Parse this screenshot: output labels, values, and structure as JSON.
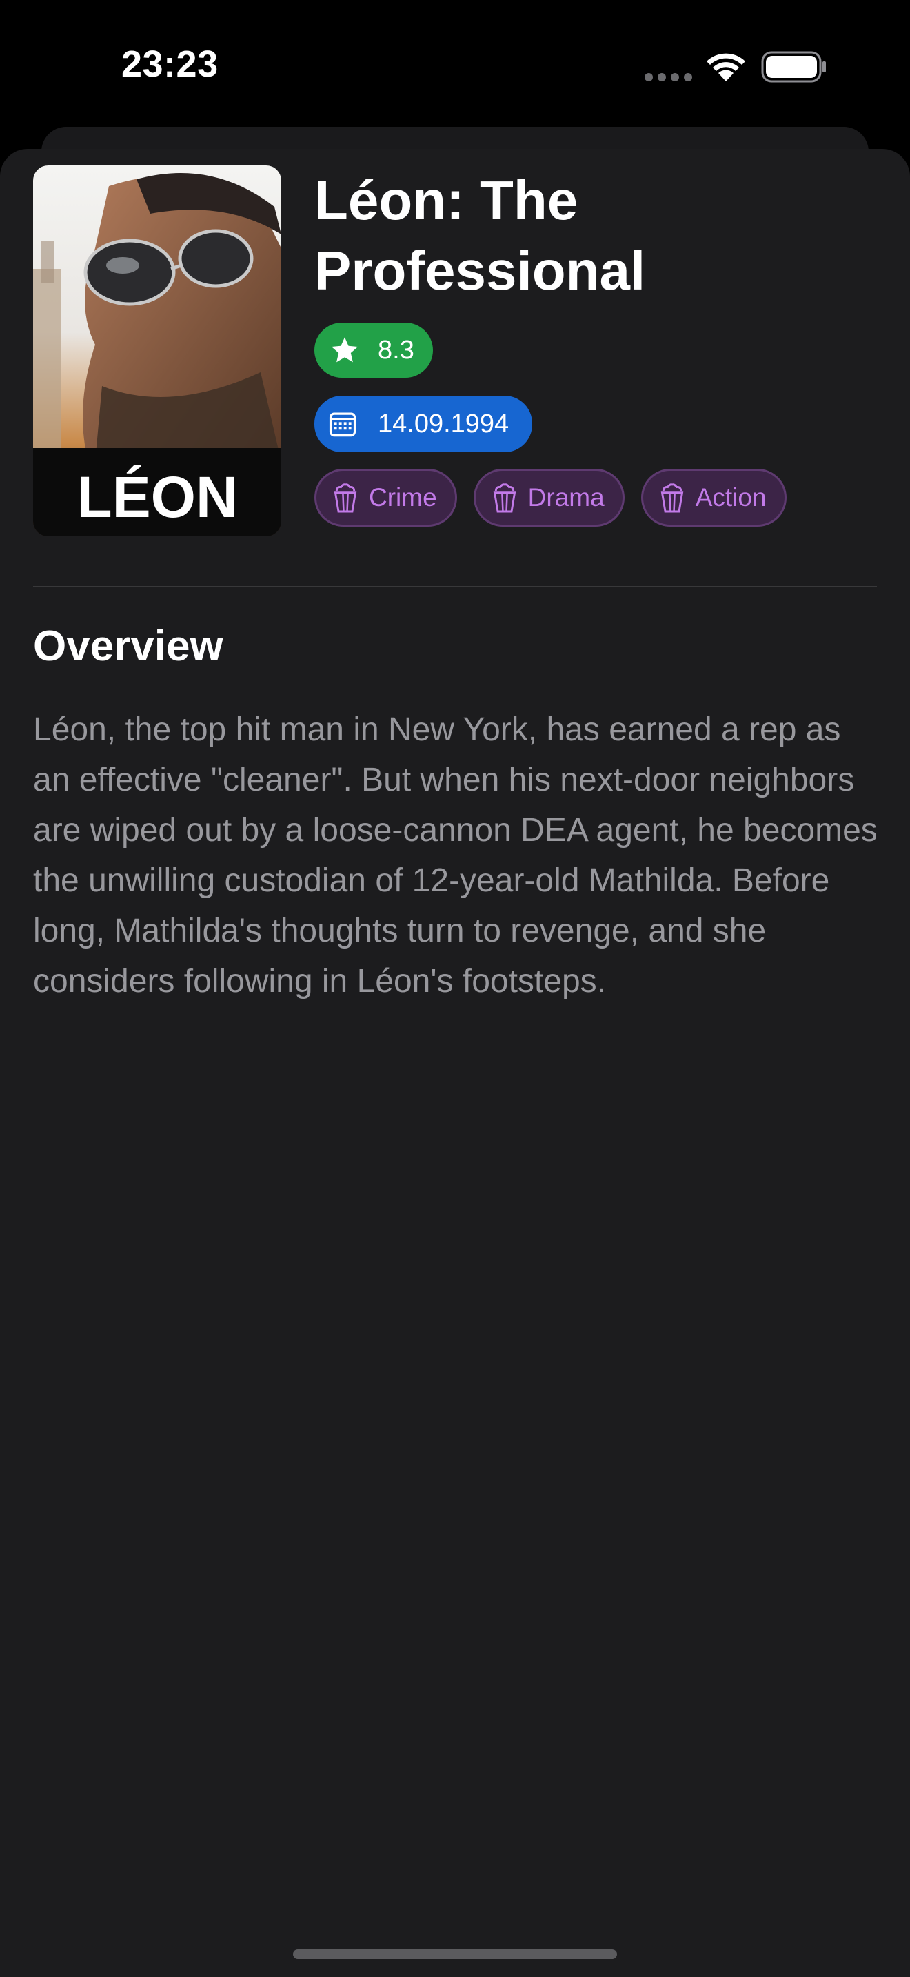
{
  "status_bar": {
    "time": "23:23"
  },
  "movie": {
    "title": "Léon: The Professional",
    "poster_text": "LÉON",
    "rating": "8.3",
    "release_date": "14.09.1994",
    "genres": [
      "Crime",
      "Drama",
      "Action"
    ]
  },
  "overview": {
    "heading": "Overview",
    "text": "Léon, the top hit man in New York, has earned a rep as an effective \"cleaner\". But when his next-door neighbors are wiped out by a loose-cannon DEA agent, he becomes the unwilling custodian of 12-year-old Mathilda. Before long, Mathilda's thoughts turn to revenge, and she considers following in Léon's footsteps."
  },
  "icons": {
    "rating": "star-icon",
    "date": "calendar-icon",
    "genre": "popcorn-icon",
    "wifi": "wifi-icon",
    "battery": "battery-icon"
  },
  "colors": {
    "background": "#1c1c1e",
    "rating_badge": "#22a148",
    "date_badge": "#1766d1",
    "genre_badge_bg": "#3c2447",
    "genre_badge_text": "#c27ae8",
    "overview_text": "#98989d"
  }
}
